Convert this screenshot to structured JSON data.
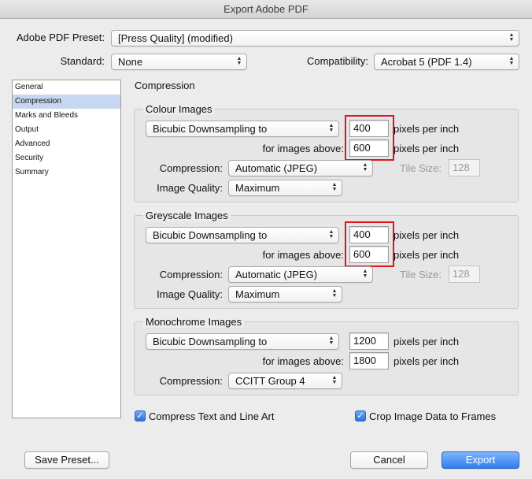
{
  "window": {
    "title": "Export Adobe PDF"
  },
  "preset": {
    "label": "Adobe PDF Preset:",
    "value": "[Press Quality] (modified)"
  },
  "standard": {
    "label": "Standard:",
    "value": "None"
  },
  "compatibility": {
    "label": "Compatibility:",
    "value": "Acrobat 5 (PDF 1.4)"
  },
  "sidebar": {
    "items": [
      {
        "label": "General"
      },
      {
        "label": "Compression"
      },
      {
        "label": "Marks and Bleeds"
      },
      {
        "label": "Output"
      },
      {
        "label": "Advanced"
      },
      {
        "label": "Security"
      },
      {
        "label": "Summary"
      }
    ],
    "selected": "Compression"
  },
  "main": {
    "section_title": "Compression",
    "colour": {
      "title": "Colour Images",
      "downsampling": "Bicubic Downsampling to",
      "ppi": "400",
      "ppi_unit": "pixels per inch",
      "above_label": "for images above:",
      "above": "600",
      "above_unit": "pixels per inch",
      "compression_label": "Compression:",
      "compression": "Automatic (JPEG)",
      "tile_label": "Tile Size:",
      "tile": "128",
      "quality_label": "Image Quality:",
      "quality": "Maximum"
    },
    "grey": {
      "title": "Greyscale Images",
      "downsampling": "Bicubic Downsampling to",
      "ppi": "400",
      "ppi_unit": "pixels per inch",
      "above_label": "for images above:",
      "above": "600",
      "above_unit": "pixels per inch",
      "compression_label": "Compression:",
      "compression": "Automatic (JPEG)",
      "tile_label": "Tile Size:",
      "tile": "128",
      "quality_label": "Image Quality:",
      "quality": "Maximum"
    },
    "mono": {
      "title": "Monochrome Images",
      "downsampling": "Bicubic Downsampling to",
      "ppi": "1200",
      "ppi_unit": "pixels per inch",
      "above_label": "for images above:",
      "above": "1800",
      "above_unit": "pixels per inch",
      "compression_label": "Compression:",
      "compression": "CCITT Group 4"
    },
    "compress_text": {
      "label": "Compress Text and Line Art",
      "checked": true
    },
    "crop_image": {
      "label": "Crop Image Data to Frames",
      "checked": true
    }
  },
  "footer": {
    "save_preset": "Save Preset...",
    "cancel": "Cancel",
    "export": "Export"
  },
  "colors": {
    "accent": "#2f7ef0",
    "highlight": "#e0141d",
    "selection": "#c7d7f0"
  }
}
